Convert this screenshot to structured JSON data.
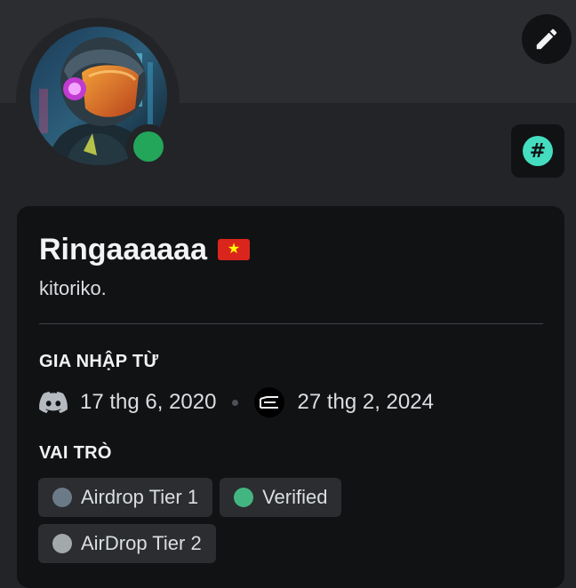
{
  "profile": {
    "display_name": "Ringaaaaaa",
    "flag_icon": "vietnam-flag-icon",
    "flag_star": "★",
    "username": "kitoriko.",
    "status": "online",
    "status_color": "#23a55a"
  },
  "actions": {
    "edit_icon": "pencil-icon",
    "hash_icon": "hashtag-icon",
    "hash_glyph": "#",
    "hash_color": "#45ddc0"
  },
  "joined": {
    "title": "GIA NHẬP TỪ",
    "discord_icon": "discord-icon",
    "discord_date": "17 thg 6, 2020",
    "server_icon": "server-icon",
    "server_date": "27 thg 2, 2024"
  },
  "roles_section": {
    "title": "VAI TRÒ",
    "roles": [
      {
        "label": "Airdrop Tier 1",
        "color": "#6b7a87"
      },
      {
        "label": "Verified",
        "color": "#43b581"
      },
      {
        "label": "AirDrop Tier 2",
        "color": "#a3a8ab"
      }
    ]
  }
}
